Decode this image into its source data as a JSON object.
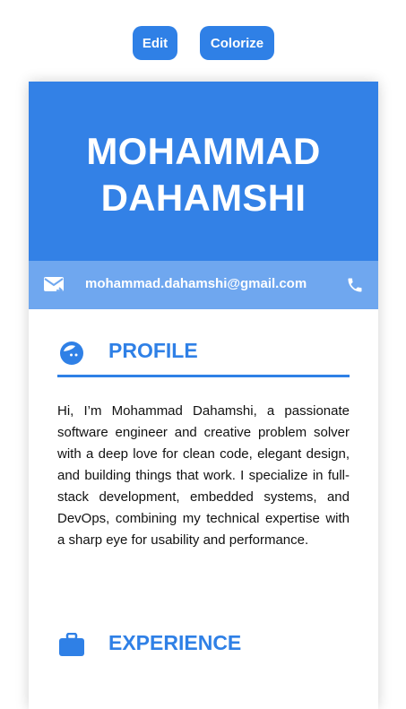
{
  "toolbar": {
    "edit_label": "Edit",
    "colorize_label": "Colorize"
  },
  "resume": {
    "name_line1": "MOHAMMAD",
    "name_line2": "DAHAMSHI",
    "contact": {
      "email": "mohammad.dahamshi@gmail.com",
      "email_icon": "email-icon",
      "phone_icon": "phone-icon"
    },
    "profile": {
      "icon": "profile-face-icon",
      "title": "PROFILE",
      "text": "Hi, I’m Mohammad Dahamshi, a passionate software engineer and creative problem solver with a deep love for clean code, elegant design, and building things that work. I specialize in full-stack development, embedded systems, and DevOps, combining my technical expertise with a sharp eye for usability and performance."
    },
    "experience": {
      "icon": "briefcase-icon",
      "title": "EXPERIENCE"
    }
  },
  "colors": {
    "accent": "#2f80e6",
    "header_bg": "#3381e6",
    "contact_bg": "#6fa7ef"
  }
}
